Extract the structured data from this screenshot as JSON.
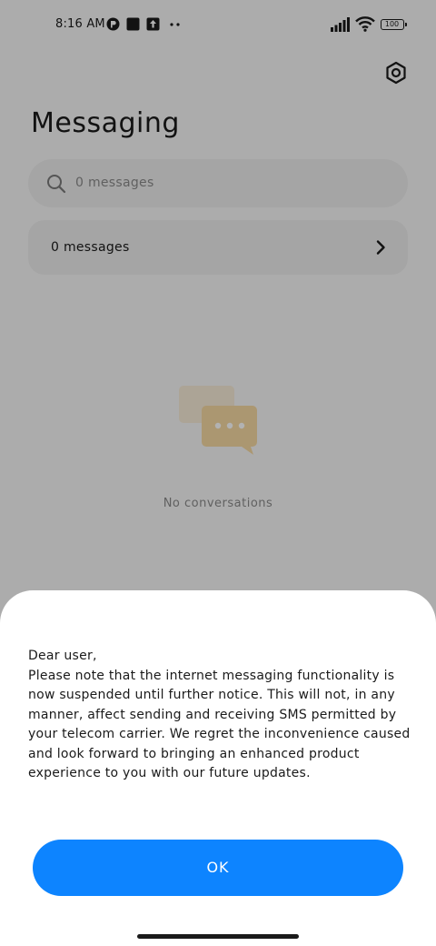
{
  "status_bar": {
    "time": "8:16 AM",
    "battery": "100",
    "icons": [
      "app-notification-icon",
      "square-notification-icon",
      "upload-notification-icon",
      "more-dots-icon",
      "signal-icon",
      "wifi-icon",
      "battery-icon"
    ]
  },
  "header": {
    "title": "Messaging",
    "settings_icon": "settings-icon"
  },
  "search": {
    "placeholder": "0 messages",
    "icon": "search-icon"
  },
  "messages_row": {
    "label": "0 messages",
    "icon": "chevron-right-icon"
  },
  "empty_state": {
    "text": "No conversations",
    "icon": "chat-bubbles-icon"
  },
  "dialog": {
    "body": "Dear user,\nPlease note that the internet messaging functionality is now suspended until further notice. This will not, in any manner, affect sending and receiving SMS permitted by your telecom carrier. We regret the inconvenience caused and look forward to bringing an enhanced product experience to you with our future updates.",
    "ok_label": "OK"
  },
  "colors": {
    "accent": "#0d84ff",
    "overlay": "rgba(0,0,0,0.30)",
    "illustration": "#f5c97a"
  }
}
